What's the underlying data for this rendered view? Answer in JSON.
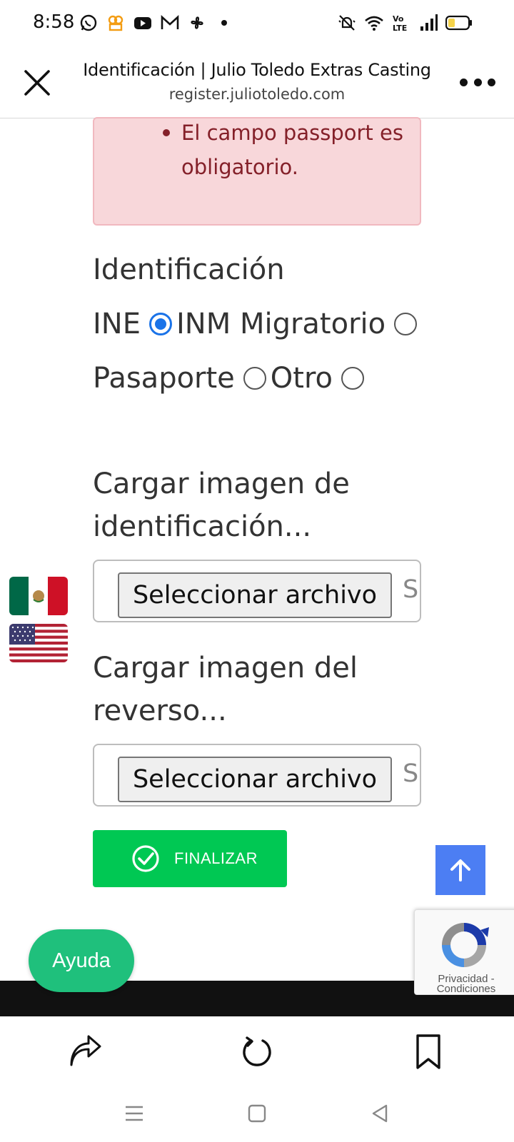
{
  "status_bar": {
    "time": "8:58",
    "left_icons": [
      "whatsapp-icon",
      "app-icon",
      "youtube-icon",
      "gmail-icon",
      "pinwheel-icon",
      "dot-icon"
    ],
    "right_icons": [
      "mute-icon",
      "wifi-icon",
      "volte-icon",
      "signal-icon",
      "battery-icon"
    ]
  },
  "browser": {
    "title": "Identificación | Julio Toledo Extras Casting",
    "url": "register.juliotoledo.com"
  },
  "alert": {
    "message": "El campo passport es obligatorio.",
    "color": "#842029",
    "background": "#f8d7da"
  },
  "form": {
    "id_heading": "Identificación",
    "id_options": [
      {
        "label": "INE",
        "selected": true
      },
      {
        "label": "INM Migratorio",
        "selected": false
      },
      {
        "label": "Pasaporte",
        "selected": false
      },
      {
        "label": "Otro",
        "selected": false
      }
    ],
    "upload_front_heading": "Cargar imagen de identificación...",
    "upload_back_heading": "Cargar imagen del reverso...",
    "file_button_label": "Seleccionar archivo",
    "file_status_text": "Si",
    "finish_label": "FINALIZAR",
    "finish_color": "#00c853"
  },
  "languages": [
    "mexico-flag-icon",
    "usa-flag-icon"
  ],
  "help_label": "Ayuda",
  "recaptcha": {
    "text": "Privacidad - Condiciones"
  },
  "bottom_bar": {
    "icons": [
      "share-icon",
      "reload-icon",
      "bookmark-icon"
    ]
  },
  "system_nav": {
    "icons": [
      "menu-icon",
      "home-icon",
      "back-icon"
    ]
  }
}
